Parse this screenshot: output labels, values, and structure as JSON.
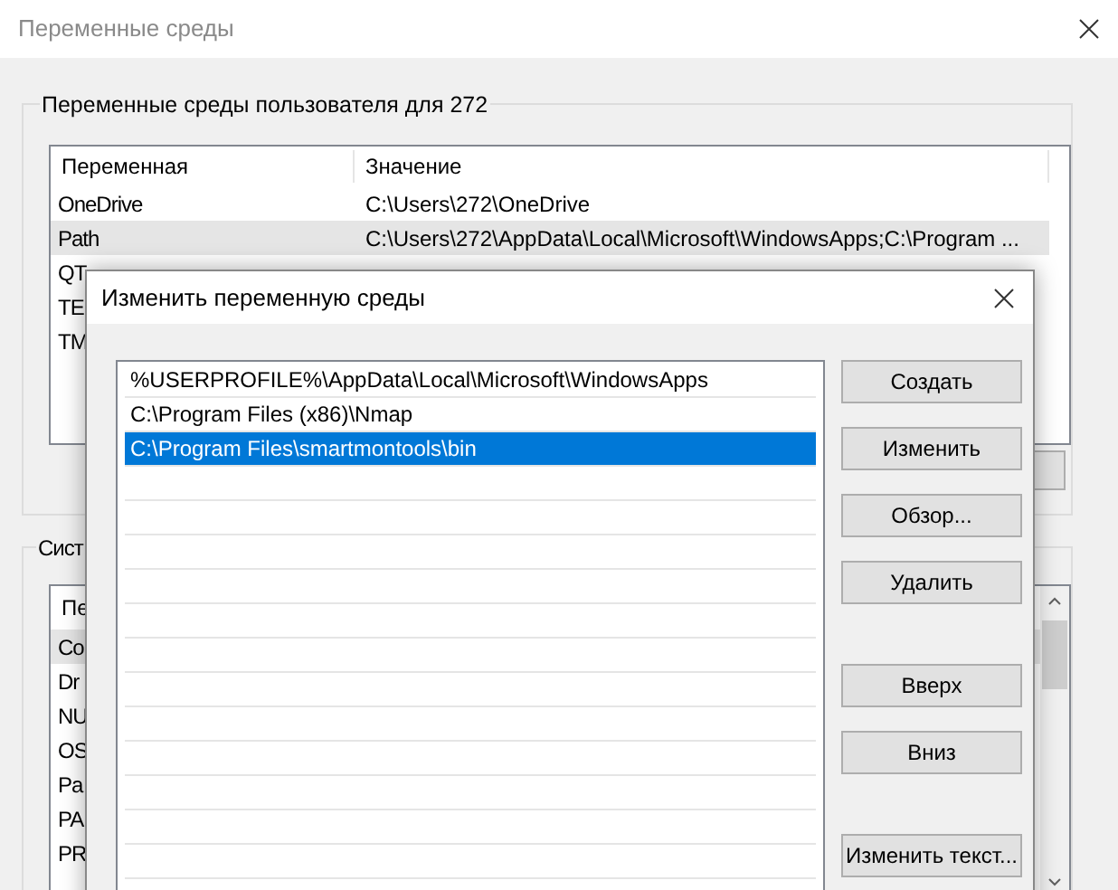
{
  "main_window": {
    "title": "Переменные среды",
    "user_group": {
      "legend": "Переменные среды пользователя для 272",
      "columns": [
        "Переменная",
        "Значение"
      ],
      "rows": [
        {
          "name": "OneDrive",
          "value": "C:\\Users\\272\\OneDrive",
          "selected": false
        },
        {
          "name": "Path",
          "value": "C:\\Users\\272\\AppData\\Local\\Microsoft\\WindowsApps;C:\\Program ...",
          "selected": true
        },
        {
          "name": "QT",
          "selected": false
        },
        {
          "name": "TE",
          "selected": false
        },
        {
          "name": "TM",
          "selected": false
        }
      ]
    },
    "system_group": {
      "legend": "Сист",
      "columns": [
        "Пе"
      ],
      "rows": [
        {
          "name": "Co",
          "selected": true
        },
        {
          "name": "Dr",
          "selected": false
        },
        {
          "name": "NU",
          "selected": false
        },
        {
          "name": "OS",
          "selected": false
        },
        {
          "name": "Pa",
          "selected": false
        },
        {
          "name": "PA",
          "selected": false
        },
        {
          "name": "PR",
          "selected": false
        }
      ]
    }
  },
  "dialog": {
    "title": "Изменить переменную среды",
    "entries": [
      {
        "text": "%USERPROFILE%\\AppData\\Local\\Microsoft\\WindowsApps",
        "selected": false
      },
      {
        "text": "C:\\Program Files (x86)\\Nmap",
        "selected": false
      },
      {
        "text": "C:\\Program Files\\smartmontools\\bin",
        "selected": true
      }
    ],
    "buttons": [
      "Создать",
      "Изменить",
      "Обзор...",
      "Удалить",
      "Вверх",
      "Вниз",
      "Изменить текст..."
    ]
  }
}
